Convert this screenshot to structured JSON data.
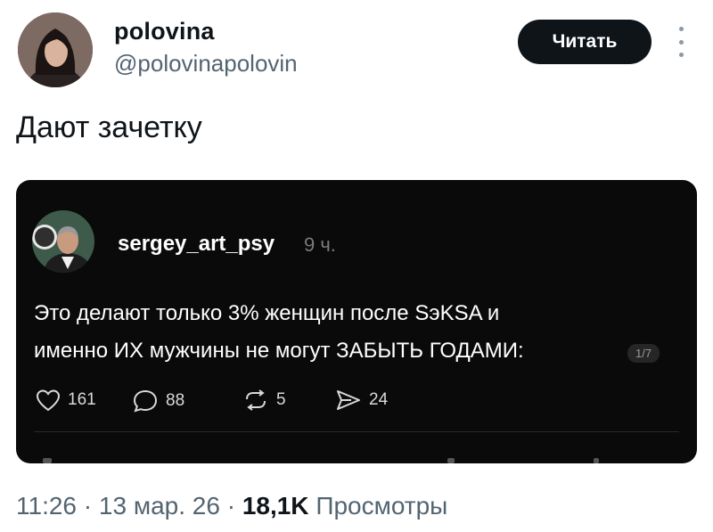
{
  "author": {
    "name": "polovina",
    "handle": "@polovinapolovin"
  },
  "follow_label": "Читать",
  "tweet_text": "Дают зачетку",
  "embedded_post": {
    "username": "sergey_art_psy",
    "time": "9 ч.",
    "line1": "Это делают только 3% женщин после SэKSA и",
    "line2": "именно ИХ мужчины не могут ЗАБЫТЬ ГОДАМИ:",
    "page_indicator": "1/7",
    "likes": "161",
    "replies": "88",
    "reposts": "5",
    "shares": "24"
  },
  "meta": {
    "time": "11:26",
    "sep1": "·",
    "date": "13 мар. 26",
    "sep2": "·",
    "views_count": "18,1K",
    "views_label": "Просмотры"
  },
  "icons": {
    "more": "vertical-dots-icon",
    "like": "heart-icon",
    "reply": "speech-bubble-icon",
    "repost": "repost-icon",
    "share": "paper-plane-icon"
  },
  "colors": {
    "follow_button_bg": "#0f1419",
    "secondary_text": "#536471",
    "card_bg": "#0a0a0a"
  }
}
